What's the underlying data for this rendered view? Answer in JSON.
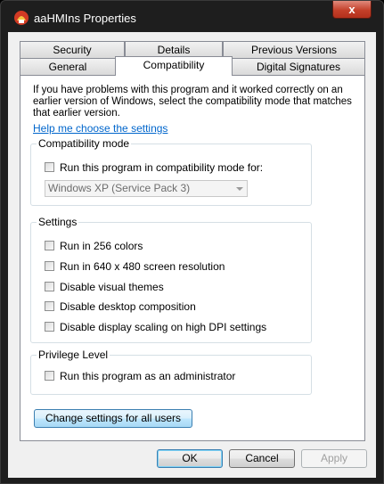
{
  "window": {
    "title": "aaHMIns Properties",
    "close_glyph": "x"
  },
  "tabs_row1": [
    "Security",
    "Details",
    "Previous Versions"
  ],
  "tabs_row2": [
    "General",
    "Compatibility",
    "Digital Signatures"
  ],
  "active_tab": "Compatibility",
  "intro_text": "If you have problems with this program and it worked correctly on an earlier version of Windows, select the compatibility mode that matches that earlier version.",
  "help_link": "Help me choose the settings",
  "compat_mode": {
    "label": "Compatibility mode",
    "checkbox_label": "Run this program in compatibility mode for:",
    "checked": false,
    "dropdown_value": "Windows XP (Service Pack 3)",
    "dropdown_enabled": false
  },
  "settings": {
    "label": "Settings",
    "items": [
      {
        "label": "Run in 256 colors",
        "checked": false
      },
      {
        "label": "Run in 640 x 480 screen resolution",
        "checked": false
      },
      {
        "label": "Disable visual themes",
        "checked": false
      },
      {
        "label": "Disable desktop composition",
        "checked": false
      },
      {
        "label": "Disable display scaling on high DPI settings",
        "checked": false
      }
    ]
  },
  "privilege": {
    "label": "Privilege Level",
    "checkbox_label": "Run this program as an administrator",
    "checked": false
  },
  "change_all_users_button": "Change settings for all users",
  "buttons": {
    "ok": "OK",
    "cancel": "Cancel",
    "apply": "Apply"
  }
}
